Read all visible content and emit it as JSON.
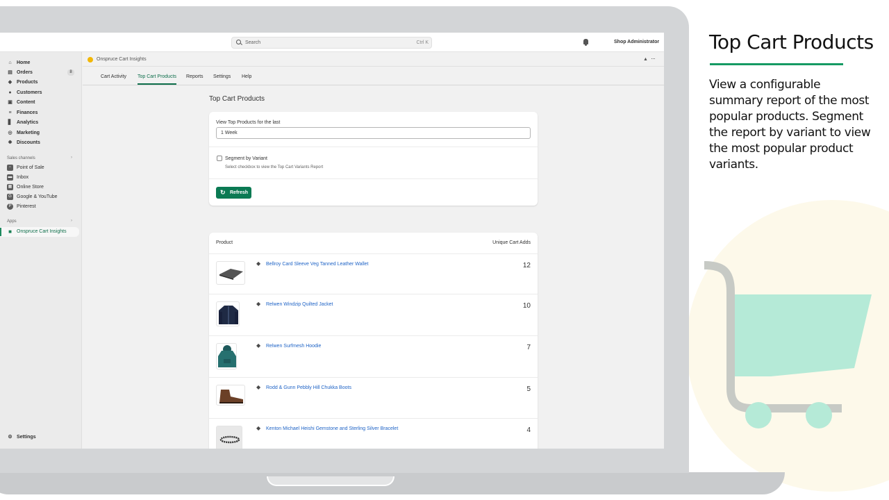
{
  "topbar": {
    "search_placeholder": "Search",
    "search_shortcut": "Ctrl K",
    "user": "Shop Administrator"
  },
  "sidebar": {
    "main": [
      {
        "label": "Home",
        "icon": "home-icon"
      },
      {
        "label": "Orders",
        "icon": "orders-icon",
        "badge": "8"
      },
      {
        "label": "Products",
        "icon": "tag-icon"
      },
      {
        "label": "Customers",
        "icon": "person-icon"
      },
      {
        "label": "Content",
        "icon": "content-icon"
      },
      {
        "label": "Finances",
        "icon": "bank-icon"
      },
      {
        "label": "Analytics",
        "icon": "chart-icon"
      },
      {
        "label": "Marketing",
        "icon": "target-icon"
      },
      {
        "label": "Discounts",
        "icon": "discount-icon"
      }
    ],
    "sales_channels_heading": "Sales channels",
    "sales_channels": [
      {
        "label": "Point of Sale",
        "icon": "pos-icon"
      },
      {
        "label": "Inbox",
        "icon": "inbox-icon"
      },
      {
        "label": "Online Store",
        "icon": "store-icon"
      },
      {
        "label": "Google & YouTube",
        "icon": "google-icon"
      },
      {
        "label": "Pinterest",
        "icon": "pinterest-icon"
      }
    ],
    "apps_heading": "Apps",
    "apps": [
      {
        "label": "Onspruce Cart Insights",
        "icon": "cart-icon"
      }
    ],
    "settings_label": "Settings"
  },
  "app": {
    "name": "Onspruce Cart Insights",
    "tabs": [
      "Cart Activity",
      "Top Cart Products",
      "Reports",
      "Settings",
      "Help"
    ],
    "active_tab": "Top Cart Products"
  },
  "page": {
    "title": "Top Cart Products",
    "filter_label": "View Top Products for the last",
    "filter_value": "1 Week",
    "segment_label": "Segment by Variant",
    "segment_help": "Select checkbox to view the Top Cart Variants Report",
    "refresh_label": "Refresh"
  },
  "table": {
    "col_product": "Product",
    "col_adds": "Unique Cart Adds",
    "rows": [
      {
        "name": "Bellroy Card Sleeve Veg Tanned Leather Wallet",
        "adds": "12"
      },
      {
        "name": "Relwen Windzip Quilted Jacket",
        "adds": "10"
      },
      {
        "name": "Relwen Surfmesh Hoodie",
        "adds": "7"
      },
      {
        "name": "Rodd & Gunn Pebbly Hill Chukka Boots",
        "adds": "5"
      },
      {
        "name": "Kenton Michael Heishi Gemstone and Sterling Silver Bracelet",
        "adds": "4"
      }
    ]
  },
  "promo": {
    "title": "Top Cart Products",
    "description": "View a configurable summary report of the most popular products. Segment the report by variant to view the most popular product variants."
  },
  "colors": {
    "accent": "#0b7a53",
    "link": "#1e63c6",
    "promo_rule": "#159a63",
    "cart_fill": "#b5ead7"
  }
}
